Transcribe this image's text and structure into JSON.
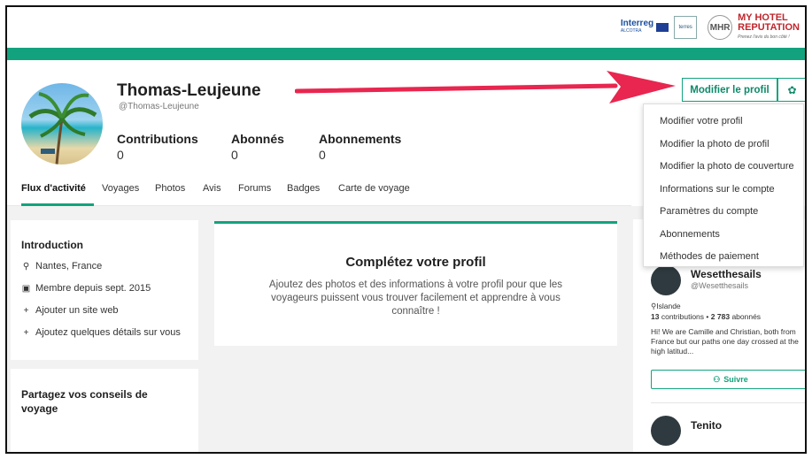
{
  "header": {
    "interreg": "Interreg",
    "interreg_sub": "ALCOTRA",
    "terres_logo": "terres",
    "mhr_badge": "MHR",
    "brand_line1": "MY HOTEL",
    "brand_line2": "REPUTATION",
    "brand_tagline": "Prenez l'avis du bon côté !"
  },
  "profile": {
    "name": "Thomas-Leujeune",
    "handle": "@Thomas-Leujeune",
    "stats": [
      {
        "label": "Contributions",
        "value": "0"
      },
      {
        "label": "Abonnés",
        "value": "0"
      },
      {
        "label": "Abonnements",
        "value": "0"
      }
    ]
  },
  "nav": {
    "tabs": [
      "Flux d'activité",
      "Voyages",
      "Photos",
      "Avis",
      "Forums",
      "Badges",
      "Carte de voyage"
    ]
  },
  "actions": {
    "edit_profile": "Modifier le profil",
    "settings_icon": "gear-icon"
  },
  "dropdown": {
    "items": [
      "Modifier votre profil",
      "Modifier la photo de profil",
      "Modifier la photo de couverture",
      "Informations sur le compte",
      "Paramètres du compte",
      "Abonnements",
      "Méthodes de paiement"
    ]
  },
  "intro": {
    "title": "Introduction",
    "location": "Nantes, France",
    "member_since": "Membre depuis sept. 2015",
    "add_website": "Ajouter un site web",
    "add_details": "Ajoutez quelques détails sur vous"
  },
  "complete_profile": {
    "title": "Complétez votre profil",
    "text": "Ajoutez des photos et des informations à votre profil pour que les voyageurs puissent vous trouver facilement et apprendre à vous connaître !"
  },
  "share": {
    "title": "Partagez vos conseils de voyage"
  },
  "suggestion": {
    "name": "Wesetthesails",
    "handle": "@Wesetthesails",
    "location": "Islande",
    "contributions": "13",
    "contributions_label": "contributions",
    "separator": "•",
    "followers": "2 783",
    "followers_label": "abonnés",
    "bio": "Hi! We are Camille and Christian, both from France but our paths one day crossed at the high latitud...",
    "follow_label": "Suivre",
    "next_name": "Tenito"
  },
  "colors": {
    "accent": "#12a37e",
    "arrow": "#e8264f"
  }
}
